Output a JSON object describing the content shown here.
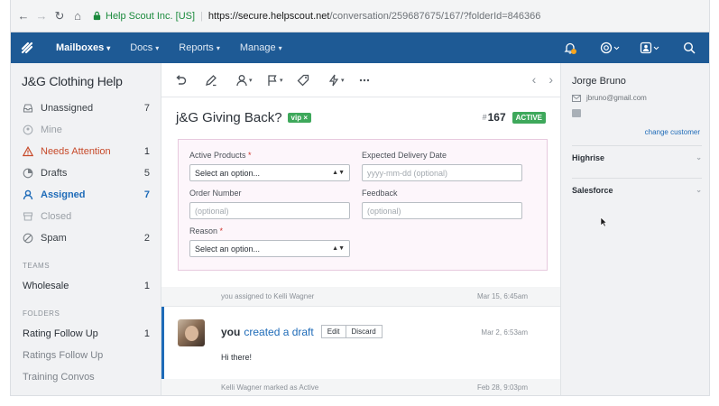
{
  "browser": {
    "secure_label": "Help Scout Inc. [US]",
    "url_host": "https://secure.helpscout.net",
    "url_path": "/conversation/259687675/167/?folderId=846366"
  },
  "topnav": {
    "items": [
      {
        "label": "Mailboxes",
        "active": true
      },
      {
        "label": "Docs",
        "active": false
      },
      {
        "label": "Reports",
        "active": false
      },
      {
        "label": "Manage",
        "active": false
      }
    ],
    "icons": [
      "bell-icon",
      "help-icon",
      "account-icon",
      "search-icon"
    ]
  },
  "sidebar": {
    "title": "J&G Clothing Help",
    "folders": [
      {
        "label": "Unassigned",
        "count": "7",
        "icon": "inbox-icon",
        "state": "normal"
      },
      {
        "label": "Mine",
        "count": "",
        "icon": "person-icon",
        "state": "dim"
      },
      {
        "label": "Needs Attention",
        "count": "1",
        "icon": "warning-icon",
        "state": "warn"
      },
      {
        "label": "Drafts",
        "count": "5",
        "icon": "drafts-icon",
        "state": "normal"
      },
      {
        "label": "Assigned",
        "count": "7",
        "icon": "assigned-icon",
        "state": "active"
      },
      {
        "label": "Closed",
        "count": "",
        "icon": "archive-icon",
        "state": "dim"
      },
      {
        "label": "Spam",
        "count": "2",
        "icon": "block-icon",
        "state": "normal"
      }
    ],
    "teams_heading": "TEAMS",
    "teams": [
      {
        "label": "Wholesale",
        "count": "1"
      }
    ],
    "folders_heading": "FOLDERS",
    "custom_folders": [
      {
        "label": "Rating Follow Up",
        "count": "1",
        "dim": false
      },
      {
        "label": "Ratings Follow Up",
        "count": "",
        "dim": true
      },
      {
        "label": "Training Convos",
        "count": "",
        "dim": true
      }
    ]
  },
  "toolbar": {
    "icons": [
      "undo-icon",
      "edit-icon",
      "assign-icon",
      "flag-icon",
      "tag-icon",
      "workflow-icon",
      "more-icon"
    ],
    "prev": "‹",
    "next": "›"
  },
  "conversation": {
    "subject": "j&G Giving Back?",
    "tag": "vip ×",
    "ticket_hash": "#",
    "ticket_number": "167",
    "status": "ACTIVE"
  },
  "custom_fields": {
    "active_products": {
      "label": "Active Products",
      "value": "Select an option..."
    },
    "expected_delivery": {
      "label": "Expected Delivery Date",
      "placeholder": "yyyy-mm-dd (optional)"
    },
    "order_number": {
      "label": "Order Number",
      "placeholder": "(optional)"
    },
    "feedback": {
      "label": "Feedback",
      "placeholder": "(optional)"
    },
    "reason": {
      "label": "Reason",
      "value": "Select an option..."
    },
    "required_mark": "*"
  },
  "activity": {
    "line1": {
      "text": "you assigned to Kelli Wagner",
      "time": "Mar 15, 6:45am"
    },
    "thread": {
      "author": "you",
      "action": "created a draft",
      "edit_label": "Edit",
      "discard_label": "Discard",
      "time": "Mar 2, 6:53am",
      "body": "Hi there!"
    },
    "line2": {
      "text": "Kelli Wagner marked as Active",
      "time": "Feb 28, 9:03pm"
    }
  },
  "customer": {
    "name": "Jorge Bruno",
    "email": "jbruno@gmail.com",
    "change_label": "change customer",
    "apps": [
      {
        "label": "Highrise"
      },
      {
        "label": "Salesforce"
      }
    ]
  },
  "colors": {
    "nav_blue": "#1e5a95",
    "link_blue": "#1e6bb8",
    "active_green": "#3ea85b",
    "warn_red": "#c74a2a"
  }
}
